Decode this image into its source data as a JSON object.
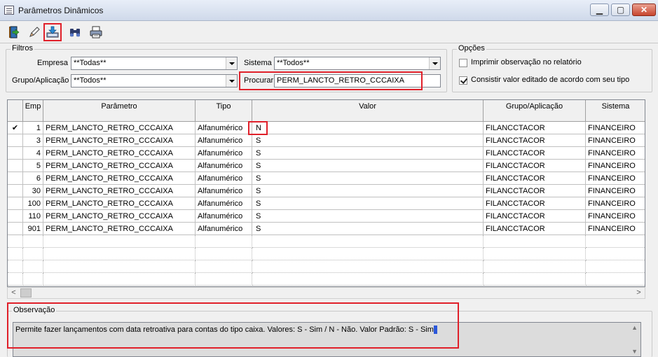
{
  "window": {
    "title": "Parâmetros Dinâmicos",
    "min_label": "▁",
    "max_label": "▢",
    "close_label": "✕"
  },
  "toolbar": [
    {
      "name": "exit-icon",
      "tooltip": ""
    },
    {
      "name": "edit-icon",
      "tooltip": ""
    },
    {
      "name": "save-icon",
      "tooltip": ""
    },
    {
      "name": "binoculars-icon",
      "tooltip": ""
    },
    {
      "name": "printer-icon",
      "tooltip": ""
    }
  ],
  "filters": {
    "legend": "Filtros",
    "empresa_label": "Empresa",
    "empresa_value": "**Todas**",
    "sistema_label": "Sistema",
    "sistema_value": "**Todos**",
    "grupo_label": "Grupo/Aplicação",
    "grupo_value": "**Todos**",
    "procurar_label": "Procurar",
    "procurar_value": "PERM_LANCTO_RETRO_CCCAIXA"
  },
  "options": {
    "legend": "Opções",
    "opt1_label": "Imprimir observação no relatório",
    "opt1_checked": false,
    "opt2_label": "Consistir valor editado de acordo com seu tipo",
    "opt2_checked": true
  },
  "grid": {
    "columns": [
      "Emp",
      "Parâmetro",
      "Tipo",
      "Valor",
      "Grupo/Aplicação",
      "Sistema"
    ],
    "rows": [
      {
        "indicator": "✔",
        "emp": "1",
        "parametro": "PERM_LANCTO_RETRO_CCCAIXA",
        "tipo": "Alfanumérico",
        "valor": "N",
        "grupo": "FILANCCTACOR",
        "sistema": "FINANCEIRO"
      },
      {
        "indicator": "",
        "emp": "3",
        "parametro": "PERM_LANCTO_RETRO_CCCAIXA",
        "tipo": "Alfanumérico",
        "valor": "S",
        "grupo": "FILANCCTACOR",
        "sistema": "FINANCEIRO"
      },
      {
        "indicator": "",
        "emp": "4",
        "parametro": "PERM_LANCTO_RETRO_CCCAIXA",
        "tipo": "Alfanumérico",
        "valor": "S",
        "grupo": "FILANCCTACOR",
        "sistema": "FINANCEIRO"
      },
      {
        "indicator": "",
        "emp": "5",
        "parametro": "PERM_LANCTO_RETRO_CCCAIXA",
        "tipo": "Alfanumérico",
        "valor": "S",
        "grupo": "FILANCCTACOR",
        "sistema": "FINANCEIRO"
      },
      {
        "indicator": "",
        "emp": "6",
        "parametro": "PERM_LANCTO_RETRO_CCCAIXA",
        "tipo": "Alfanumérico",
        "valor": "S",
        "grupo": "FILANCCTACOR",
        "sistema": "FINANCEIRO"
      },
      {
        "indicator": "",
        "emp": "30",
        "parametro": "PERM_LANCTO_RETRO_CCCAIXA",
        "tipo": "Alfanumérico",
        "valor": "S",
        "grupo": "FILANCCTACOR",
        "sistema": "FINANCEIRO"
      },
      {
        "indicator": "",
        "emp": "100",
        "parametro": "PERM_LANCTO_RETRO_CCCAIXA",
        "tipo": "Alfanumérico",
        "valor": "S",
        "grupo": "FILANCCTACOR",
        "sistema": "FINANCEIRO"
      },
      {
        "indicator": "",
        "emp": "110",
        "parametro": "PERM_LANCTO_RETRO_CCCAIXA",
        "tipo": "Alfanumérico",
        "valor": "S",
        "grupo": "FILANCCTACOR",
        "sistema": "FINANCEIRO"
      },
      {
        "indicator": "",
        "emp": "901",
        "parametro": "PERM_LANCTO_RETRO_CCCAIXA",
        "tipo": "Alfanumérico",
        "valor": "S",
        "grupo": "FILANCCTACOR",
        "sistema": "FINANCEIRO"
      }
    ]
  },
  "scroll": {
    "left": "<",
    "right": ">"
  },
  "observacao": {
    "legend": "Observação",
    "text": "Permite fazer lançamentos com data retroativa para contas do tipo caixa. Valores: S - Sim / N - Não. Valor Padrão: S - Sim"
  },
  "colors": {
    "highlight": "#e0202a",
    "caret": "#2b57d9"
  }
}
